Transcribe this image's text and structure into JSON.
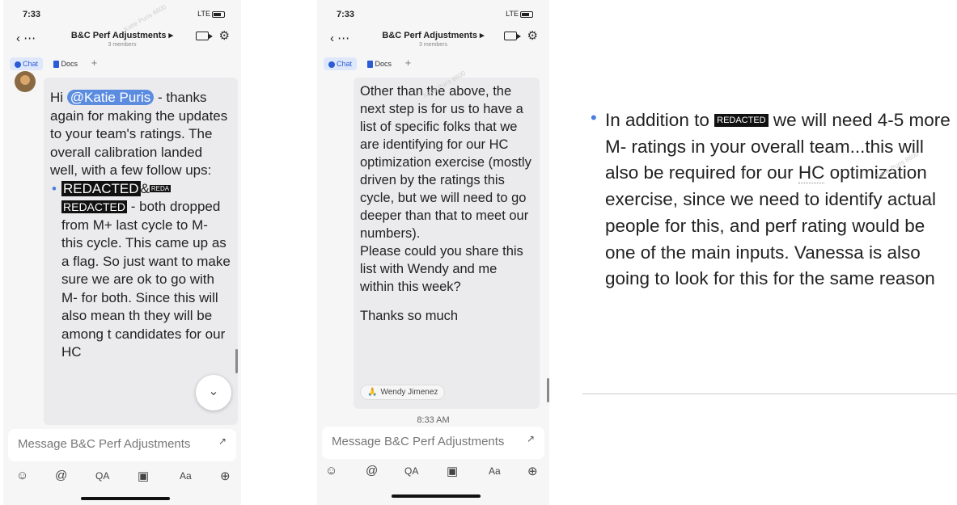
{
  "phone1": {
    "status": {
      "time": "7:33",
      "network": "LTE"
    },
    "header": {
      "title": "B&C Perf Adjustments ▸",
      "members": "3 members"
    },
    "tabs": {
      "chat": "Chat",
      "docs": "Docs",
      "add": "+"
    },
    "message": {
      "greeting": "Hi",
      "mention": "@Katie Puris",
      "intro": "- thanks again for making the updates to your team's ratings. The overall calibration landed well, with a few follow ups:",
      "redacted_a": "REDACTED",
      "amp": "&",
      "redacted_b_small": "REDA",
      "redacted_c": "REDACTED",
      "bullet_text": "- both dropped from M+ last cycle to M- this cycle. This came up as a flag. So just want to make sure we are ok to go with M- for both. Since this will also mean th they will be among t candidates for our HC"
    },
    "input_placeholder": "Message B&C Perf Adjustments",
    "toolbar": {
      "emoji": "☺",
      "mention": "@",
      "qa": "QA",
      "image": "▣",
      "format": "Aa",
      "more": "⊕"
    }
  },
  "phone2": {
    "status": {
      "time": "7:33",
      "network": "LTE"
    },
    "header": {
      "title": "B&C Perf Adjustments ▸",
      "members": "3 members"
    },
    "tabs": {
      "chat": "Chat",
      "docs": "Docs",
      "add": "+"
    },
    "message": {
      "body": "Other than the above, the next step is for us to have a list of specific folks that we are identifying for our HC optimization exercise (mostly driven by the ratings this cycle, but we will need to go deeper than that to meet our numbers).",
      "request": "Please could you share this list with Wendy and me within this week?",
      "thanks": "Thanks so much"
    },
    "reaction": {
      "emoji": "🙏",
      "name": "Wendy Jimenez"
    },
    "timestamp": "8:33 AM",
    "input_placeholder": "Message B&C Perf Adjustments",
    "toolbar": {
      "emoji": "☺",
      "mention": "@",
      "qa": "QA",
      "image": "▣",
      "format": "Aa",
      "more": "⊕"
    }
  },
  "panel3": {
    "prefix": "In addition to",
    "redacted": "REDACTED",
    "line1_rest": "we will need",
    "text_before_hc": "4-5 more M- ratings in your overall team...this will also be required for our",
    "hc": "HC",
    "text_after_hc": "optimization exercise, since we need to identify actual people for this, and perf rating would be one of the main inputs. Vanessa is also going to look for this for the same reason"
  },
  "watermark": "Katie Puris 8600",
  "colors": {
    "accent": "#2c5bd6",
    "mention_bg": "#5b8ce0",
    "bubble": "#ebebed"
  }
}
